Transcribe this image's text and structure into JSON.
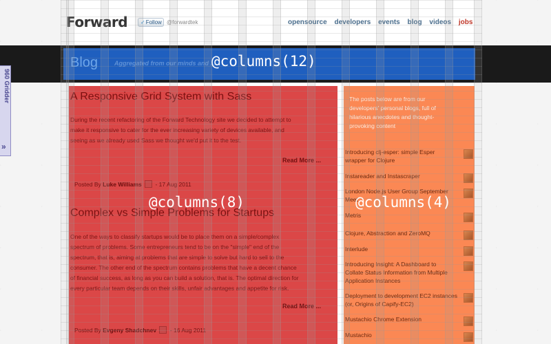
{
  "header": {
    "logo": "Forward",
    "follow_button": "Follow",
    "twitter_handle": "@forwardtek",
    "nav": [
      "opensource",
      "developers",
      "events",
      "blog",
      "videos",
      "jobs"
    ]
  },
  "banner": {
    "title": "Blog",
    "tagline": "Aggregated from our minds and ..."
  },
  "overlay_labels": {
    "columns_12": "@columns(12)",
    "columns_8": "@columns(8)",
    "columns_4": "@columns(4)"
  },
  "gridder": {
    "label": "960 Gridder",
    "toggle": "»"
  },
  "posts": [
    {
      "title": "A Responsive Grid System with Sass",
      "body_lines": [
        "During the recent refactoring of the Forward Technology site we decided to attempt to",
        "make it responsive to cater for the ever increasing variety of devices available, and",
        "seeing as we already used Sass we thought we'd put it to the test."
      ],
      "read_more": "Read More ...",
      "posted_by": "Posted By",
      "author": "Luke Williams",
      "date": "- 17 Aug 2011"
    },
    {
      "title": "Complex vs Simple Problems for Startups",
      "body_lines": [
        "One of the ways to classify startups would be to place them on a simple/complex",
        "spectrum of problems. Some entrepreneurs tend to be on the \"simple\" end of the",
        "spectrum, that is, aiming at problems that are simple to solve but hard to sell to the",
        "consumer. The other end of the spectrum contains problems that have a decent chance",
        "of financial success, as long as you can build a solution, that is. The optimal direction for",
        "every particular team depends on their skills, unfair advantages and appetite for risk."
      ],
      "read_more": "Read More ...",
      "posted_by": "Posted By",
      "author": "Evgeny Shadchnev",
      "date": "- 16 Aug 2011"
    }
  ],
  "sidebar": {
    "intro_lines": [
      "The posts below are from our",
      "developers' personal blogs, full of",
      "hilarious anecdotes and thought-",
      "provoking content"
    ],
    "links": [
      [
        "Introducing clj-esper: simple Esper",
        "wrapper for Clojure"
      ],
      [
        "Instareader and Instascraper"
      ],
      [
        "London Node.js User Group September",
        "Meet"
      ],
      [
        "Metris"
      ],
      [
        "Clojure, Abstraction and ZeroMQ"
      ],
      [
        "Interlude"
      ],
      [
        "Introducing Insight: A Dashboard to",
        "Collate Status Information from Multiple",
        "Application Instances"
      ],
      [
        "Deployment to development EC2 instances",
        "(or, Origins of Capify-EC2)"
      ],
      [
        "Mustachio Chrome Extension"
      ],
      [
        "Mustachio"
      ]
    ]
  }
}
